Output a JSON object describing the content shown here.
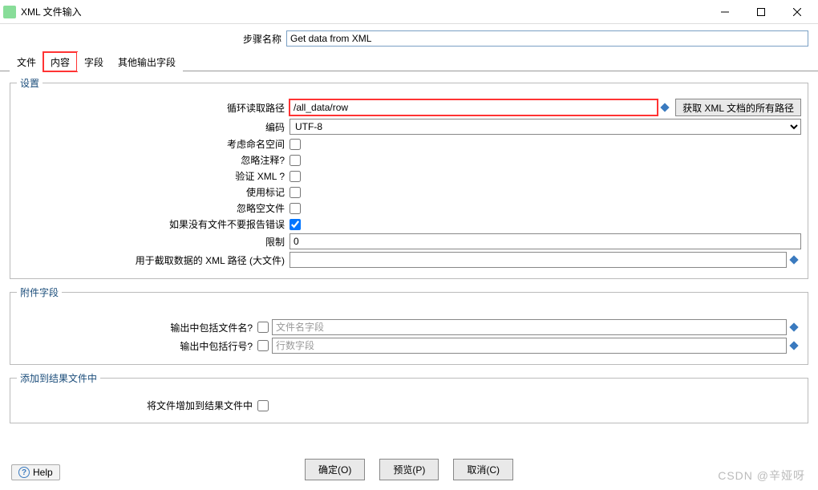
{
  "window": {
    "title": "XML 文件输入"
  },
  "step": {
    "label": "步骤名称",
    "value": "Get data from XML"
  },
  "tabs": [
    "文件",
    "内容",
    "字段",
    "其他输出字段"
  ],
  "settings": {
    "legend": "设置",
    "loop_path": {
      "label": "循环读取路径",
      "value": "/all_data/row",
      "button": "获取 XML 文档的所有路径"
    },
    "encoding": {
      "label": "编码",
      "value": "UTF-8"
    },
    "namespace": {
      "label": "考虑命名空间"
    },
    "ignore_comments": {
      "label": "忽略注释?"
    },
    "validate_xml": {
      "label": "验证 XML ?"
    },
    "use_markers": {
      "label": "使用标记"
    },
    "ignore_empty": {
      "label": "忽略空文件"
    },
    "no_error_no_file": {
      "label": "如果没有文件不要报告错误"
    },
    "limit": {
      "label": "限制",
      "value": "0"
    },
    "xml_path_big": {
      "label": "用于截取数据的 XML 路径 (大文件)",
      "value": ""
    }
  },
  "attach": {
    "legend": "附件字段",
    "include_filename": {
      "label": "输出中包括文件名?",
      "placeholder": "文件名字段"
    },
    "include_rownum": {
      "label": "输出中包括行号?",
      "placeholder": "行数字段"
    }
  },
  "addresult": {
    "legend": "添加到结果文件中",
    "add_to_result": {
      "label": "将文件增加到结果文件中"
    }
  },
  "buttons": {
    "ok": "确定(O)",
    "preview": "预览(P)",
    "cancel": "取消(C)"
  },
  "help": "Help",
  "watermark": "CSDN @辛娅呀"
}
